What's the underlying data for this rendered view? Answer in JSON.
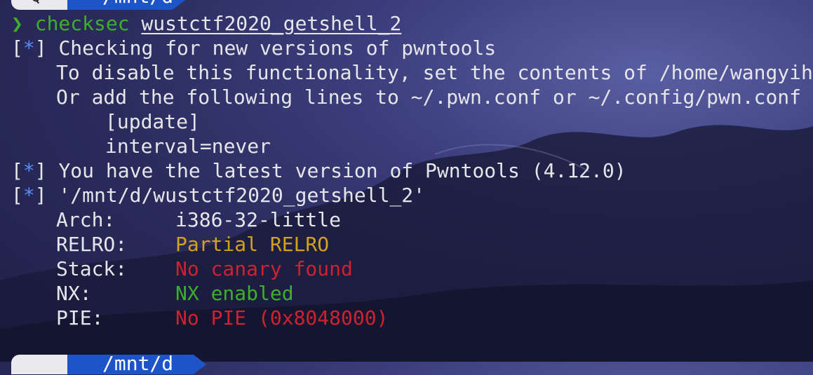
{
  "prompt_top": {
    "icon": "search-icon",
    "path": "/mnt/d"
  },
  "command": {
    "symbol": "❯",
    "name": "checksec",
    "arg": "wustctf2020_getshell_2"
  },
  "lines": {
    "l1_tag": "*",
    "l1": "Checking for new versions of pwntools",
    "l2": "To disable this functionality, set the contents of /home/wangyih",
    "l3": "Or add the following lines to ~/.pwn.conf or ~/.config/pwn.conf",
    "l4": "[update]",
    "l5": "interval=never",
    "l6_tag": "*",
    "l6": "You have the latest version of Pwntools (4.12.0)",
    "l7_tag": "*",
    "l7": "'/mnt/d/wustctf2020_getshell_2'"
  },
  "checksec": [
    {
      "key": "Arch:",
      "value": "i386-32-little",
      "color": "#e6e6ea"
    },
    {
      "key": "RELRO:",
      "value": "Partial RELRO",
      "color": "#d4a21a"
    },
    {
      "key": "Stack:",
      "value": "No canary found",
      "color": "#d0212e"
    },
    {
      "key": "NX:",
      "value": "NX enabled",
      "color": "#3fae2a"
    },
    {
      "key": "PIE:",
      "value": "No PIE (0x8048000)",
      "color": "#d0212e"
    }
  ],
  "prompt_bottom": {
    "path": "/mnt/d"
  }
}
